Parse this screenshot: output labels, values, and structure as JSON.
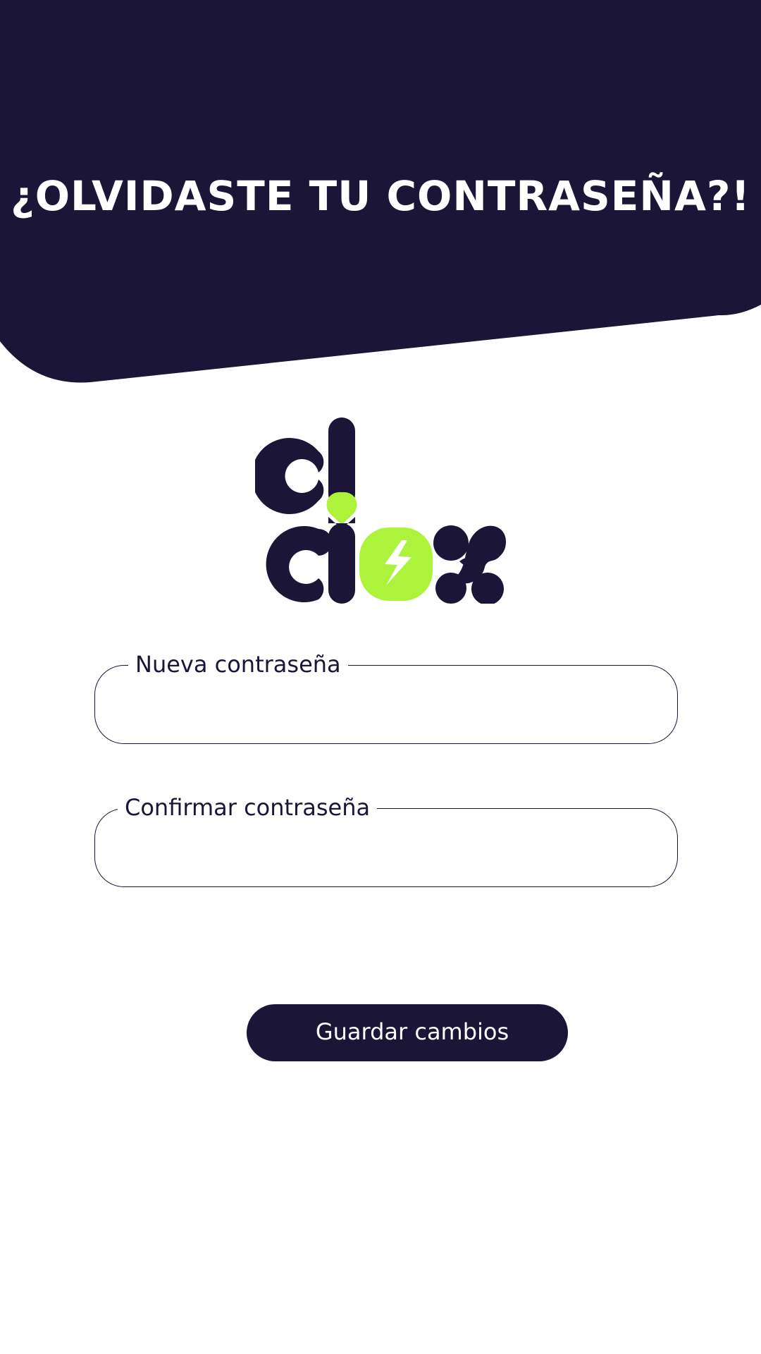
{
  "colors": {
    "navy": "#1b1538",
    "lime": "#adf23b",
    "white": "#ffffff"
  },
  "header": {
    "title": "¿OLVIDASTE TU CONTRASEÑA?!"
  },
  "logo": {
    "name": "clicx-logo"
  },
  "form": {
    "new_password": {
      "label": "Nueva contraseña",
      "value": ""
    },
    "confirm_password": {
      "label": "Confirmar contraseña",
      "value": ""
    },
    "save_label": "Guardar cambios"
  }
}
